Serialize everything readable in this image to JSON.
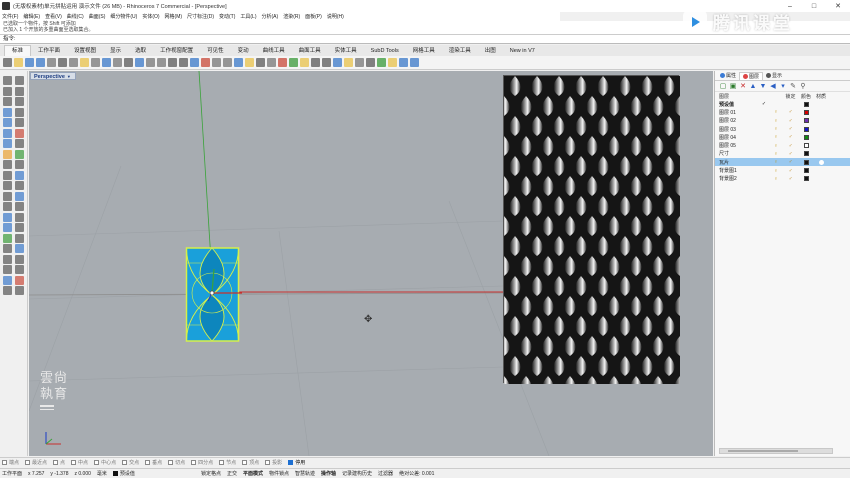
{
  "window": {
    "title": "(无版权素材)单元拼贴运用 演示文件 (26 MB) - Rhinoceros 7 Commercial - [Perspective]",
    "minimize": "–",
    "maximize": "□",
    "close": "✕"
  },
  "menu": [
    "文件(F)",
    "编辑(E)",
    "查看(V)",
    "曲线(C)",
    "曲面(S)",
    "细分物件(U)",
    "实体(O)",
    "网格(M)",
    "尺寸标注(D)",
    "变动(T)",
    "工具(L)",
    "分析(A)",
    "渲染(R)",
    "面板(P)",
    "说明(H)"
  ],
  "command_history": [
    "已选取一个物件，按 Shift 可添加",
    "已加入 1 个开放的多重曲面至选取集合。"
  ],
  "command_prompt": "指令:",
  "tabs": [
    "标准",
    "工作平面",
    "设置视图",
    "显示",
    "选取",
    "工作视窗配置",
    "可见性",
    "变动",
    "曲线工具",
    "曲面工具",
    "实体工具",
    "SubD Tools",
    "网格工具",
    "渲染工具",
    "出图",
    "New in V7"
  ],
  "active_tab_index": 0,
  "viewport": {
    "label": "Perspective"
  },
  "watermark": {
    "line1": "雲尙",
    "line2": "執育"
  },
  "logo": {
    "text": "腾讯课堂"
  },
  "panel": {
    "tabs": [
      "属性",
      "图层",
      "显示"
    ],
    "headers": {
      "name": "图层",
      "current": "",
      "lock": "锁定",
      "color": "颜色",
      "material": "材质"
    },
    "layers": [
      {
        "name": "预设值",
        "current": "✓",
        "color": "#111111",
        "bold": true
      },
      {
        "name": "图层 01",
        "color": "#d40000"
      },
      {
        "name": "图层 02",
        "color": "#6d2fb1"
      },
      {
        "name": "图层 03",
        "color": "#1212c8"
      },
      {
        "name": "图层 04",
        "color": "#108a10"
      },
      {
        "name": "图层 05",
        "color": "#ffffff"
      },
      {
        "name": "尺寸",
        "color": "#111111"
      },
      {
        "name": "瓦片",
        "color": "#111111",
        "selected": true
      },
      {
        "name": "背景图1",
        "color": "#111111"
      },
      {
        "name": "背景图2",
        "color": "#111111"
      }
    ]
  },
  "osnaps": [
    {
      "label": "端点",
      "on": false
    },
    {
      "label": "最近点",
      "on": false
    },
    {
      "label": "点",
      "on": false
    },
    {
      "label": "中点",
      "on": false
    },
    {
      "label": "中心点",
      "on": false
    },
    {
      "label": "交点",
      "on": false
    },
    {
      "label": "垂点",
      "on": false
    },
    {
      "label": "切点",
      "on": false
    },
    {
      "label": "四分点",
      "on": false
    },
    {
      "label": "节点",
      "on": false
    },
    {
      "label": "顶点",
      "on": false
    },
    {
      "label": "投影",
      "on": false
    },
    {
      "label": "停用",
      "on": true
    }
  ],
  "status": {
    "cplane": "工作平面",
    "x": "x 7.257",
    "y": "y -1.378",
    "z": "z 0.000",
    "units": "毫米",
    "layer": "预设值",
    "toggles": [
      "锁定格点",
      "正交",
      "平面模式",
      "物件锁点",
      "智慧轨迹",
      "操作轴",
      "记录建构历史",
      "过滤器",
      "绝对公差: 0.001"
    ],
    "bold_toggles": [
      2,
      5
    ]
  }
}
